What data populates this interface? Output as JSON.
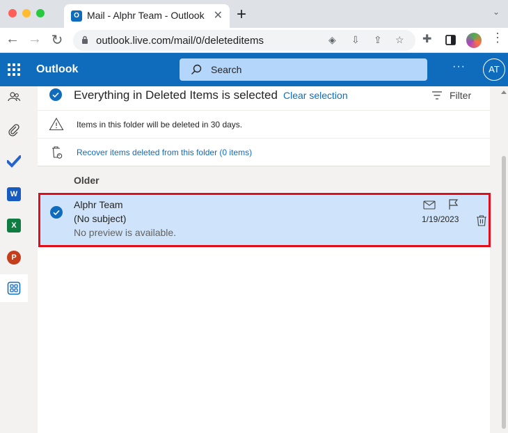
{
  "browser": {
    "tab_title": "Mail - Alphr Team - Outlook",
    "tab_close": "✕",
    "new_tab": "+",
    "url": "outlook.live.com/mail/0/deleteditems"
  },
  "header": {
    "app_name": "Outlook",
    "search_placeholder": "Search",
    "more": "···",
    "avatar_initials": "AT",
    "brand_color": "#0f6cbd"
  },
  "rail": {
    "items": [
      "people-icon",
      "paperclip-icon",
      "todo-check-icon",
      "word-icon",
      "excel-icon",
      "powerpoint-icon",
      "apps-icon"
    ],
    "word_letter": "W",
    "excel_letter": "X",
    "powerpoint_letter": "P"
  },
  "selection": {
    "text": "Everything in Deleted Items is selected",
    "clear_label": "Clear selection",
    "filter_label": "Filter"
  },
  "notices": {
    "retention": "Items in this folder will be deleted in 30 days.",
    "recover": "Recover items deleted from this folder (0 items)"
  },
  "group": {
    "label": "Older"
  },
  "messages": [
    {
      "sender": "Alphr Team",
      "subject": "(No subject)",
      "preview": "No preview is available.",
      "date": "1/19/2023",
      "selected": true
    }
  ],
  "colors": {
    "selected_row": "#cfe4fa",
    "highlight_outline": "#e00d1a",
    "link": "#0f6cbd"
  }
}
